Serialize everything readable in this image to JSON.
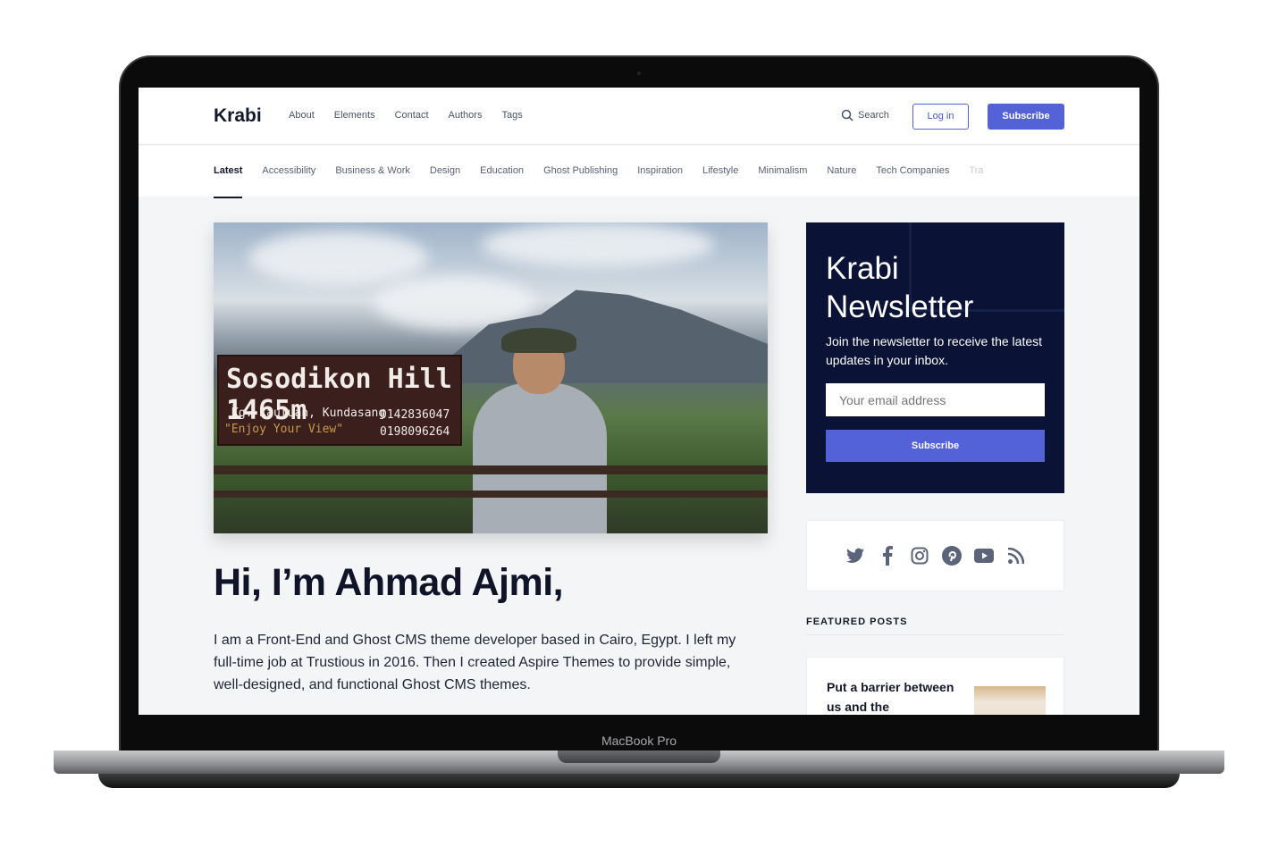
{
  "device": {
    "label": "MacBook Pro"
  },
  "header": {
    "logo": "Krabi",
    "nav": [
      "About",
      "Elements",
      "Contact",
      "Authors",
      "Tags"
    ],
    "search": "Search",
    "login": "Log in",
    "subscribe": "Subscribe"
  },
  "tags": [
    "Latest",
    "Accessibility",
    "Business & Work",
    "Design",
    "Education",
    "Ghost Publishing",
    "Inspiration",
    "Lifestyle",
    "Minimalism",
    "Nature",
    "Tech Companies",
    "Tra"
  ],
  "photo": {
    "sign_title": "Sosodikon Hill 1465m",
    "sign_place": "Kg. Kauluan, Kundasang",
    "sign_motto": "\"Enjoy Your View\"",
    "sign_phone1": "0142836047",
    "sign_phone2": "0198096264"
  },
  "main": {
    "title": "Hi, I’m Ahmad Ajmi,",
    "bio": "I am a Front-End and Ghost CMS theme developer based in Cairo, Egypt. I left my full-time job at Trustious in 2016. Then I created Aspire Themes to provide simple, well-designed, and functional Ghost CMS themes."
  },
  "newsletter": {
    "title": "Krabi Newsletter",
    "text": "Join the newsletter to receive the latest updates in your inbox.",
    "placeholder": "Your email address",
    "button": "Subscribe"
  },
  "social": {
    "icons": [
      "twitter-icon",
      "facebook-icon",
      "instagram-icon",
      "pinterest-icon",
      "youtube-icon",
      "rss-icon"
    ],
    "color": "#5b6478"
  },
  "featured": {
    "heading": "FEATURED POSTS",
    "post_title": "Put a barrier between us and the"
  },
  "colors": {
    "accent": "#5462d8",
    "newsletter_bg": "#0a1235"
  }
}
